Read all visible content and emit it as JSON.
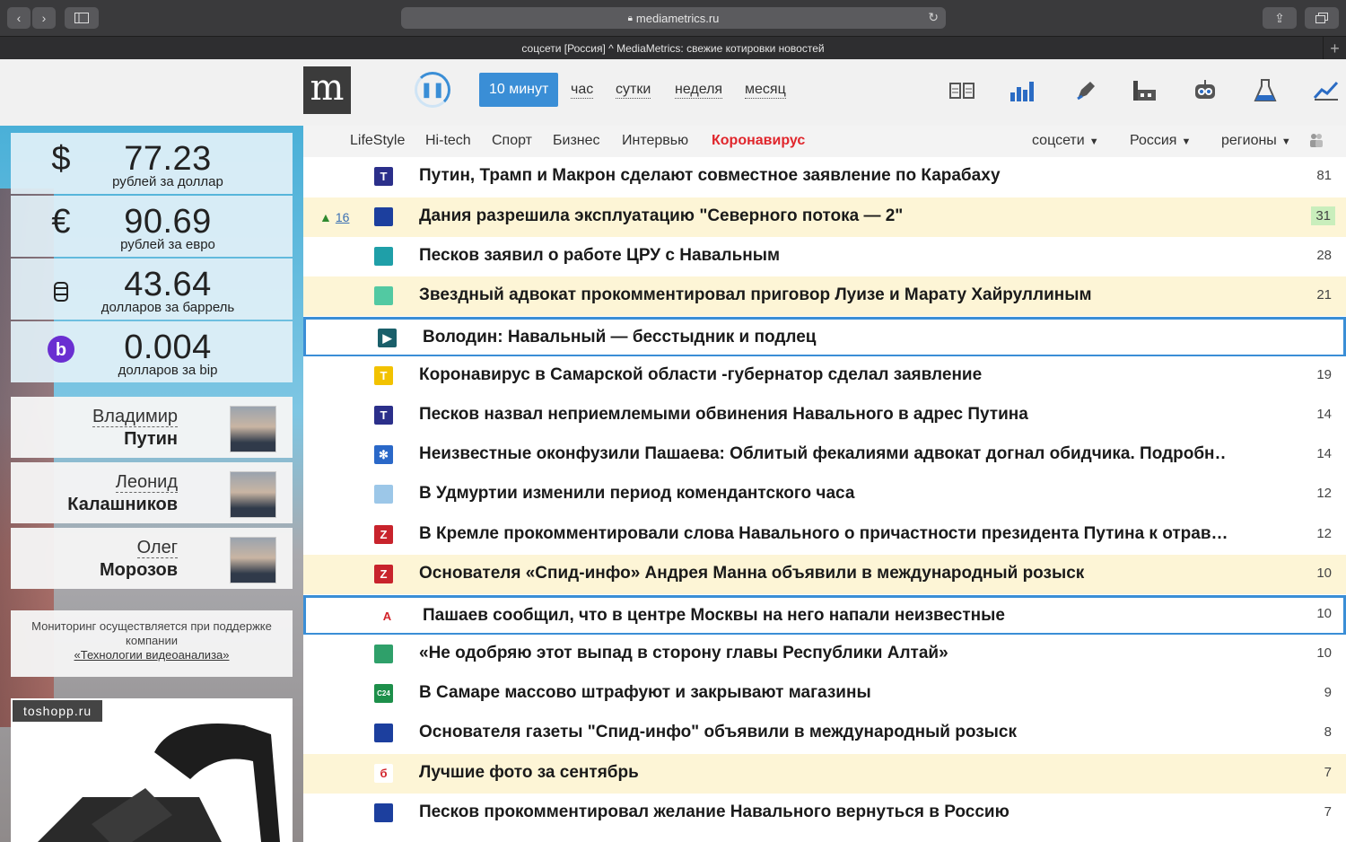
{
  "browser": {
    "url": "mediametrics.ru",
    "tab_title": "соцсети [Россия] ^ MediaMetrics: свежие котировки новостей"
  },
  "header": {
    "logo": "m",
    "periods": [
      "10 минут",
      "час",
      "сутки",
      "неделя",
      "месяц"
    ],
    "active_period": "10 минут",
    "toolbar_icons": [
      "columns-icon",
      "bar-chart-icon",
      "pen-icon",
      "factory-icon",
      "robot-icon",
      "flask-icon",
      "line-chart-icon"
    ]
  },
  "categories": [
    "LifeStyle",
    "Hi-tech",
    "Спорт",
    "Бизнес",
    "Интервью",
    "Коронавирус"
  ],
  "filters": [
    "соцсети",
    "Россия",
    "регионы"
  ],
  "rates": [
    {
      "symbol": "$",
      "value": "77.23",
      "unit": "рублей за доллар"
    },
    {
      "symbol": "€",
      "value": "90.69",
      "unit": "рублей за евро"
    },
    {
      "symbol": "barrel",
      "value": "43.64",
      "unit": "долларов за баррель"
    },
    {
      "symbol": "b",
      "value": "0.004",
      "unit": "долларов за bip"
    }
  ],
  "people": [
    {
      "first": "Владимир",
      "last": "Путин"
    },
    {
      "first": "Леонид",
      "last": "Калашников"
    },
    {
      "first": "Олег",
      "last": "Морозов"
    }
  ],
  "sponsor": {
    "text": "Мониторинг осуществляется при поддержке компании",
    "link": "«Технологии видеоанализа»"
  },
  "ad": {
    "tag": "toshopp.ru"
  },
  "news": [
    {
      "title": "Путин, Трамп и Макрон сделают совместное заявление по Карабаху",
      "count": "81",
      "src_color": "#2b2f8a",
      "src_text": "T"
    },
    {
      "title": "Дания разрешила эксплуатацию \"Северного потока — 2\"",
      "count": "31",
      "src_color": "#1c3f9e",
      "src_text": "",
      "trend": "16",
      "highlight": true,
      "green": true
    },
    {
      "title": "Песков заявил о работе ЦРУ с Навальным",
      "count": "28",
      "src_color": "#1f9fa8",
      "src_text": ""
    },
    {
      "title": "Звездный адвокат прокомментировал приговор Луизе и Марату Хайруллиным",
      "count": "21",
      "src_color": "#52c9a2",
      "src_text": "",
      "highlight": true
    },
    {
      "title": "Володин: Навальный — бесстыдник и подлец",
      "count": "",
      "src_color": "#1a5f6a",
      "src_text": "▶",
      "boxed": true
    },
    {
      "title": "Коронавирус в Самарской области -губернатор сделал заявление",
      "count": "19",
      "src_color": "#f2c200",
      "src_text": "T"
    },
    {
      "title": "Песков назвал неприемлемыми обвинения Навального в адрес Путина",
      "count": "14",
      "src_color": "#2b2f8a",
      "src_text": "T"
    },
    {
      "title": "Неизвестные оконфузили Пашаева: Облитый фекалиями адвокат догнал обидчика. Подробн…",
      "count": "14",
      "src_color": "#2a68c8",
      "src_text": "✻"
    },
    {
      "title": "В Удмуртии изменили период комендантского часа",
      "count": "12",
      "src_color": "#9cc7e8",
      "src_text": ""
    },
    {
      "title": "В Кремле прокомментировали слова Навального о причастности президента Путина к отрав…",
      "count": "12",
      "src_color": "#c8232c",
      "src_text": "Z"
    },
    {
      "title": "Основателя «Спид-инфо» Андрея Манна объявили в международный розыск",
      "count": "10",
      "src_color": "#c8232c",
      "src_text": "Z",
      "highlight": true
    },
    {
      "title": "Пашаев сообщил, что в центре Москвы на него напали неизвестные",
      "count": "10",
      "src_color": "#ffffff",
      "src_text": "A",
      "boxed": true
    },
    {
      "title": "«Не одобряю этот выпад в сторону главы Республики Алтай»",
      "count": "10",
      "src_color": "#2fa06a",
      "src_text": ""
    },
    {
      "title": "В Самаре массово штрафуют и закрывают магазины",
      "count": "9",
      "src_color": "#1d8f4a",
      "src_text": "C24"
    },
    {
      "title": "Основателя газеты \"Спид-инфо\" объявили в международный розыск",
      "count": "8",
      "src_color": "#1c3f9e",
      "src_text": ""
    },
    {
      "title": "Лучшие фото за сентябрь",
      "count": "7",
      "src_color": "#ffffff",
      "src_text": "б",
      "highlight": true
    },
    {
      "title": "Песков прокомментировал желание Навального вернуться в Россию",
      "count": "7",
      "src_color": "#1c3f9e",
      "src_text": ""
    }
  ]
}
